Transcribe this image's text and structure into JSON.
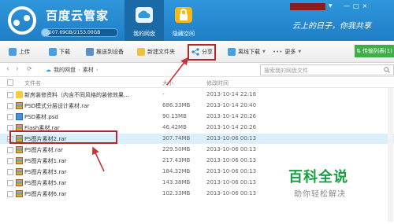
{
  "header": {
    "app_title": "百度云管家",
    "quota_text": "207.69GB/2153.00GB",
    "quota_fraction": 0.1,
    "tabs": [
      {
        "label": "我的网盘",
        "icon": "cloud-icon",
        "active": true
      },
      {
        "label": "隐藏空间",
        "icon": "lock-icon",
        "active": false
      }
    ],
    "slogan": "云上的日子，你我共享",
    "window_controls": [
      "—",
      "□",
      "×"
    ]
  },
  "toolbar": {
    "items": [
      {
        "label": "上传",
        "icon": "upload-icon"
      },
      {
        "label": "下载",
        "icon": "download-icon"
      },
      {
        "label": "推送到设备",
        "icon": "push-device-icon"
      },
      {
        "label": "新建文件夹",
        "icon": "new-folder-icon"
      },
      {
        "label": "分享",
        "icon": "share-icon"
      },
      {
        "label": "离线下载",
        "icon": "offline-download-icon"
      },
      {
        "label": "更多",
        "icon": "more-icon"
      }
    ],
    "transfer_label": "传输列表(1)"
  },
  "address": {
    "back": "‹",
    "forward": "›",
    "crumbs": [
      "我的网盘",
      "素材"
    ],
    "search_placeholder": "搜索我的网盘文件"
  },
  "columns": {
    "name": "文件名",
    "size": "大小",
    "date": "修改时间"
  },
  "files": [
    {
      "name": "新房装修资料（内含不同风格的装修效果...",
      "size": "-",
      "date": "2013-10-14 22:18",
      "type": "folder",
      "selected": false
    },
    {
      "name": "PSD模式分层设计素材.rar",
      "size": "686.33MB",
      "date": "2013-10-14 20:40",
      "type": "rar",
      "selected": false
    },
    {
      "name": "PSD素材.psd",
      "size": "90.13MB",
      "date": "2013-10-14 20:26",
      "type": "psd",
      "selected": false
    },
    {
      "name": "Flash素材.rar",
      "size": "46.42MB",
      "date": "2013-10-14 20:26",
      "type": "rar",
      "selected": false
    },
    {
      "name": "PS图片素材2.rar",
      "size": "307.74MB",
      "date": "2013-10-06 00:13",
      "type": "rar",
      "selected": true
    },
    {
      "name": "PS图片素材.rar",
      "size": "229.50MB",
      "date": "2013-10-06 00:13",
      "type": "rar",
      "selected": false
    },
    {
      "name": "PS图片素材1.rar",
      "size": "217.43MB",
      "date": "2013-10-06 00:13",
      "type": "rar",
      "selected": false
    },
    {
      "name": "PS图片素材3.rar",
      "size": "184.32MB",
      "date": "2013-10-06 00:13",
      "type": "rar",
      "selected": false
    },
    {
      "name": "PS图片素材5.rar",
      "size": "143.38MB",
      "date": "2013-10-06 00:13",
      "type": "rar",
      "selected": false
    },
    {
      "name": "PS图片素材6.rar",
      "size": "102.33MB",
      "date": "2013-10-06 00:13",
      "type": "rar",
      "selected": false
    }
  ],
  "watermark": {
    "title": "百科全说",
    "subtitle": "助你轻松解决"
  },
  "colors": {
    "header_blue": "#2f97dc",
    "highlight_red": "#b3262b",
    "transfer_green": "#3fae49",
    "selected_row": "#dbeefc"
  }
}
